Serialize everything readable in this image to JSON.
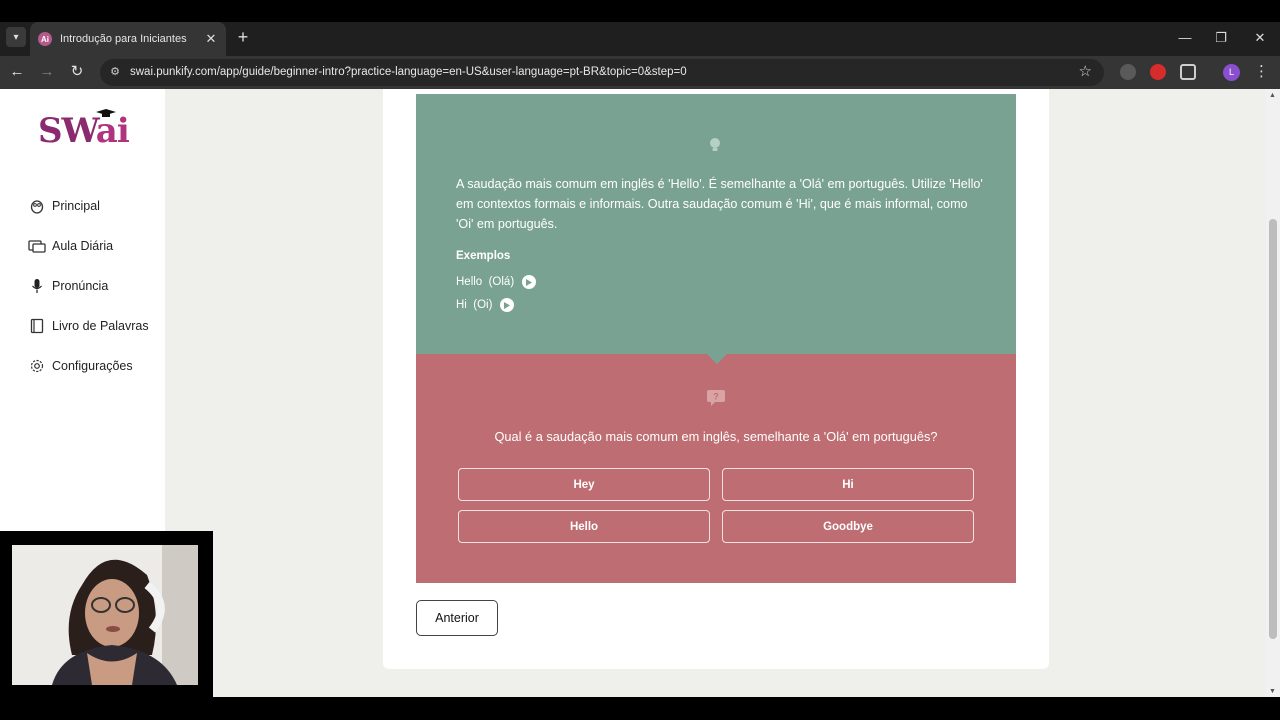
{
  "browser": {
    "tab_title": "Introdução para Iniciantes",
    "tab_favicon": "swai-favicon",
    "url_host": "swai.punkify.com",
    "url_path": "/app/guide/beginner-intro?practice-language=en-US&user-language=pt-BR&topic=0&step=0",
    "profile_initial": "L"
  },
  "sidebar": {
    "logo_text_sw": "SW",
    "logo_text_ai": "ai",
    "items": [
      {
        "label": "Principal",
        "icon": "owl-icon"
      },
      {
        "label": "Aula Diária",
        "icon": "screens-icon"
      },
      {
        "label": "Pronúncia",
        "icon": "microphone-icon"
      },
      {
        "label": "Livro de Palavras",
        "icon": "book-icon"
      },
      {
        "label": "Configurações",
        "icon": "gear-icon"
      }
    ]
  },
  "lesson": {
    "info_text": "A saudação mais comum em inglês é 'Hello'. É semelhante a 'Olá' em português. Utilize 'Hello' em contextos formais e informais. Outra saudação comum é 'Hi', que é mais informal, como 'Oi' em português.",
    "examples_title": "Exemplos",
    "examples": [
      {
        "text": "Hello  (Olá)"
      },
      {
        "text": "Hi  (Oi)"
      }
    ]
  },
  "quiz": {
    "question": "Qual é a saudação mais comum em inglês, semelhante a 'Olá' em português?",
    "options": [
      "Hey",
      "Hi",
      "Hello",
      "Goodbye"
    ]
  },
  "navigation": {
    "previous_label": "Anterior"
  },
  "colors": {
    "info_box": "#7aa293",
    "quiz_box": "#be6e72",
    "brand": "#8b2a6f"
  }
}
